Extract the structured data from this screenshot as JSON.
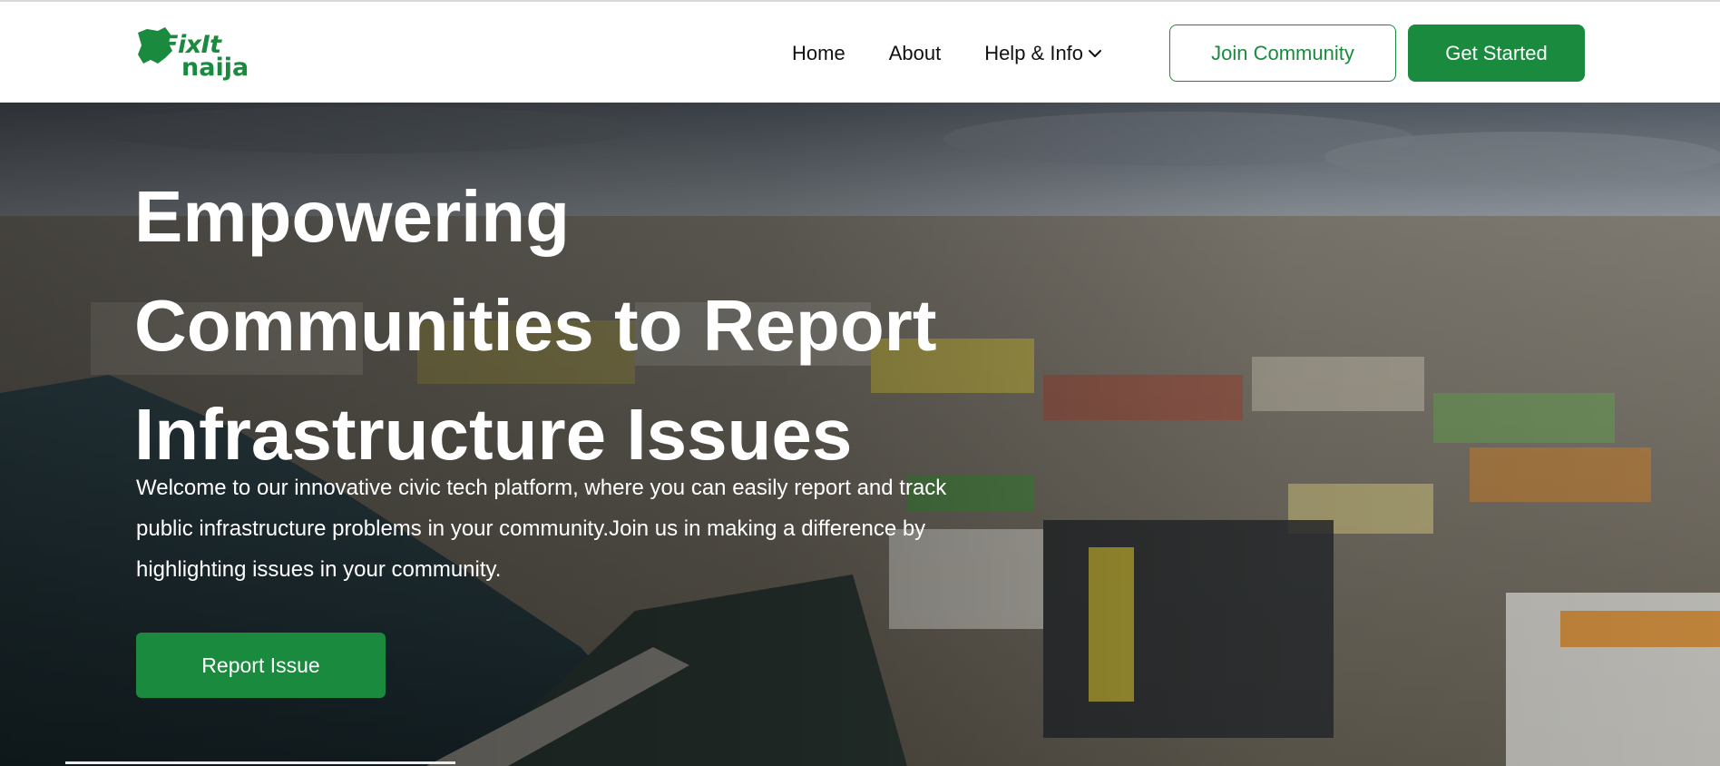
{
  "brand": {
    "logo_line1": "FixIt",
    "logo_line2": "naija",
    "color": "#1a8a3f"
  },
  "nav": {
    "items": [
      {
        "label": "Home"
      },
      {
        "label": "About"
      },
      {
        "label": "Help & Info",
        "icon": "chevron-down-icon"
      }
    ],
    "join_label": "Join Community",
    "start_label": "Get Started"
  },
  "hero": {
    "title_line1": "Empowering",
    "title_line2": "Communities to Report",
    "title_line3": "Infrastructure Issues",
    "subtitle": "Welcome to our innovative civic tech platform, where you can easily report and track public infrastructure problems in your community.Join us in making a difference by highlighting issues in your community.",
    "cta_label": "Report Issue",
    "background": "aerial-city-photo"
  },
  "colors": {
    "primary": "#1a8a3f",
    "text_dark": "#111111",
    "white": "#ffffff"
  }
}
